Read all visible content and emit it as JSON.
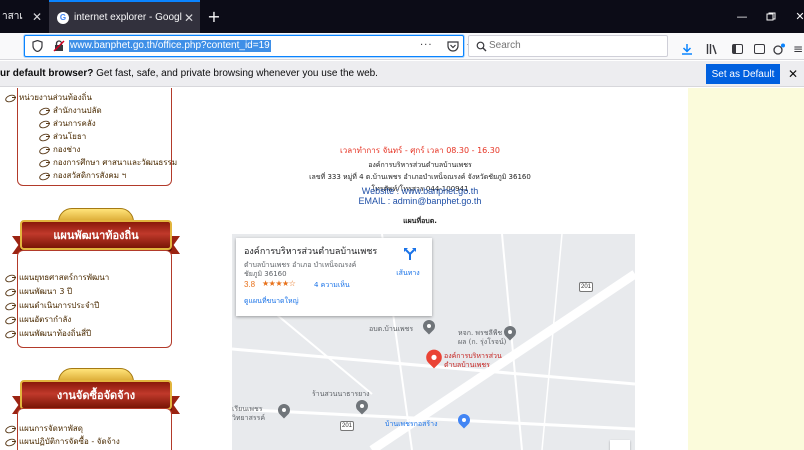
{
  "browser": {
    "tabs": [
      {
        "title": "าสาเ",
        "close": "✕"
      },
      {
        "title": "internet explorer - Google Sear",
        "close": "✕"
      }
    ],
    "new_tab": "+",
    "url": "www.banphet.go.th/office.php?content_id=19",
    "page_actions": "···",
    "search_placeholder": "Search"
  },
  "notification": {
    "bold_text": "ur default browser?",
    "text": " Get fast, safe, and private browsing whenever you use the web.",
    "button": "Set as Default",
    "close": "✕"
  },
  "sidebar": {
    "group1": [
      "หน่วยงานส่วนท้องถิ่น",
      "สำนักงานปลัด",
      "ส่วนการคลัง",
      "ส่วนโยธา",
      "กองช่าง",
      "กองการศึกษา ศาสนาและวัฒนธรรม",
      "กองสวัสดิการสังคม ฯ"
    ],
    "banner1": "แผนพัฒนาท้องถิ่น",
    "group2": [
      "แผนยุทธศาสตร์การพัฒนา",
      "แผนพัฒนา 3 ปี",
      "แผนดำเนินการประจำปี",
      "แผนอัตรากำลัง",
      "แผนพัฒนาท้องถิ่นสี่ปี"
    ],
    "banner2": "งานจัดซื้อจัดจ้าง",
    "group3": [
      "แผนการจัดหาพัสดุ",
      "แผนปฏิบัติการจัดซื้อ - จัดจ้าง"
    ]
  },
  "contact": {
    "hours": "เวลาทำการ จันทร์ - ศุกร์ เวลา 08.30 - 16.30",
    "org": "องค์การบริหารส่วนตำบลบ้านเพชร",
    "address": "เลขที่ 333 หมู่ที่ 4 ต.บ้านเพชร อำเภอบำเหน็จณรงค์ จังหวัดชัยภูมิ 36160",
    "phone": "โทรศัพท์/โทรสาร 044-100941",
    "email": "EMAIL : admin@banphet.go.th",
    "website": "Website : www.banphet.go.th",
    "map_title": "แผนที่อบต."
  },
  "map": {
    "place_title": "องค์การบริหารส่วนตำบลบ้านเพชร",
    "place_addr1": "ตำบลบ้านเพชร อำเภอ บำเหน็จณรงค์",
    "place_addr2": "ชัยภูมิ 36160",
    "rating": "3.8",
    "stars": "★★★★☆",
    "reviews": "4 ความเห็น",
    "directions": "เส้นทาง",
    "larger_map": "ดูแผนที่ขนาดใหญ่",
    "labels": {
      "obt": "อบต.บ้านเพชร",
      "hospital": "หจก. พรชลีพืช",
      "hospital2": "ผล (ก. รุ่งโรจน์)",
      "main_pin": "องค์การบริหารส่วน",
      "main_pin2": "ตำบลบ้านเพชร",
      "shop": "ร้านสวนนาธารยาง",
      "school": "เรียนเพชร",
      "school2": "วิทยาสรรค์",
      "phet": "บ้านเพชรกอสร้าง"
    },
    "road_201_a": "201",
    "road_201_b": "201"
  },
  "colors": {
    "accent": "#0a84ff",
    "tabbar": "#0c0c17",
    "maroon": "#b23a2a",
    "hours_red": "#e63323",
    "link_blue": "#1f4fa6",
    "pin_red": "#ea4335",
    "pin_gray": "#70757a"
  }
}
